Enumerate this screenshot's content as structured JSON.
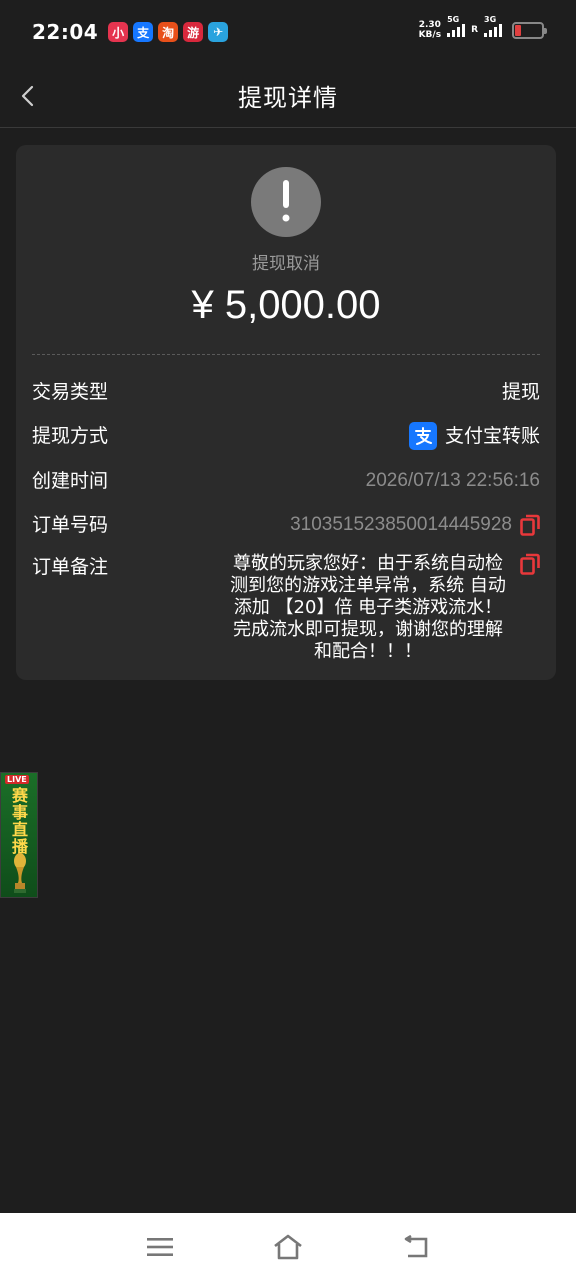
{
  "status_bar": {
    "time": "22:04",
    "net_speed_value": "2.30",
    "net_speed_unit": "KB/s",
    "signal1_label": "5G",
    "signal2_label": "3G",
    "roaming": "R",
    "battery_level": 0.22,
    "app_icons": [
      {
        "name": "xiaohongshu-icon",
        "glyph": "小",
        "color": "#e5344f"
      },
      {
        "name": "alipay-app-icon",
        "glyph": "支",
        "color": "#1677ff"
      },
      {
        "name": "taobao-icon",
        "glyph": "淘",
        "color": "#e8501a"
      },
      {
        "name": "game-app-icon",
        "glyph": "游",
        "color": "#d8283c"
      },
      {
        "name": "telegram-icon",
        "glyph": "✈",
        "color": "#2aa3de"
      }
    ]
  },
  "header": {
    "title": "提现详情"
  },
  "detail": {
    "status": "提现取消",
    "amount": "¥ 5,000.00",
    "rows": {
      "type_label": "交易类型",
      "type_value": "提现",
      "method_label": "提现方式",
      "method_icon": "alipay-icon",
      "method_value": "支付宝转账",
      "created_label": "创建时间",
      "created_value": "2026/07/13 22:56:16",
      "order_label": "订单号码",
      "order_value": "310351523850014445928",
      "note_label": "订单备注",
      "note_value": "尊敬的玩家您好：由于系统自动检测到您的游戏注单异常，系统 自动添加 【20】倍 电子类游戏流水！完成流水即可提现，谢谢您的理解和配合！！！"
    }
  },
  "live_banner": {
    "tag": "LIVE",
    "text": "赛事直播"
  },
  "colors": {
    "background": "#1e1e1e",
    "card": "#2b2b2b",
    "copy_icon": "#e8383b",
    "alipay": "#1677ff",
    "muted_text": "#8c8c8c"
  }
}
